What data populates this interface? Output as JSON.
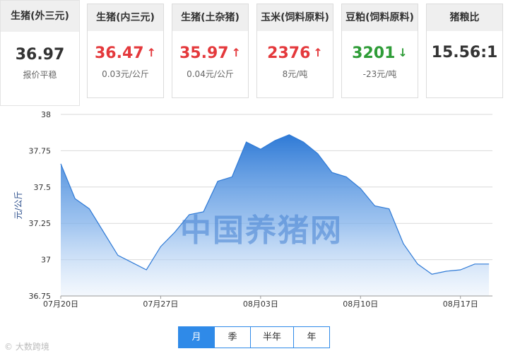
{
  "cards": [
    {
      "name": "生猪(外三元)",
      "price": "36.97",
      "arrow": "",
      "change": "报价平稳",
      "color": "dark"
    },
    {
      "name": "生猪(内三元)",
      "price": "36.47",
      "arrow": "↑",
      "change": "0.03元/公斤",
      "color": "red"
    },
    {
      "name": "生猪(土杂猪)",
      "price": "35.97",
      "arrow": "↑",
      "change": "0.04元/公斤",
      "color": "red"
    },
    {
      "name": "玉米(饲料原料)",
      "price": "2376",
      "arrow": "↑",
      "change": "8元/吨",
      "color": "red"
    },
    {
      "name": "豆粕(饲料原料)",
      "price": "3201",
      "arrow": "↓",
      "change": "-23元/吨",
      "color": "green"
    },
    {
      "name": "猪粮比",
      "price": "15.56:1",
      "arrow": "",
      "change": "",
      "color": "dark"
    }
  ],
  "colors": {
    "red": "#e4393c",
    "green": "#2e9c37",
    "accent": "#2f8ae8",
    "line": "#2f7ad6"
  },
  "watermark": "中国养猪网",
  "footer_logo": "© 大数跨境",
  "tabs": [
    {
      "label": "月",
      "selected": true
    },
    {
      "label": "季",
      "selected": false
    },
    {
      "label": "半年",
      "selected": false
    },
    {
      "label": "年",
      "selected": false
    }
  ],
  "chart_data": {
    "type": "area",
    "ylabel": "元/公斤",
    "ylim": [
      36.75,
      38
    ],
    "yticks": [
      "36.75",
      "37",
      "37.25",
      "37.5",
      "37.75",
      "38"
    ],
    "xticks": [
      "07月20日",
      "07月27日",
      "08月03日",
      "08月10日",
      "08月17日"
    ],
    "x": [
      "07-20",
      "07-21",
      "07-22",
      "07-23",
      "07-24",
      "07-25",
      "07-26",
      "07-27",
      "07-28",
      "07-29",
      "07-30",
      "07-31",
      "08-01",
      "08-02",
      "08-03",
      "08-04",
      "08-05",
      "08-06",
      "08-07",
      "08-08",
      "08-09",
      "08-10",
      "08-11",
      "08-12",
      "08-13",
      "08-14",
      "08-15",
      "08-16",
      "08-17",
      "08-18",
      "08-19"
    ],
    "values": [
      37.66,
      37.42,
      37.35,
      37.19,
      37.03,
      36.98,
      36.93,
      37.09,
      37.19,
      37.31,
      37.33,
      37.54,
      37.57,
      37.81,
      37.76,
      37.82,
      37.86,
      37.81,
      37.73,
      37.6,
      37.57,
      37.49,
      37.37,
      37.35,
      37.11,
      36.97,
      36.9,
      36.92,
      36.93,
      36.97,
      36.97
    ],
    "grid": true
  }
}
